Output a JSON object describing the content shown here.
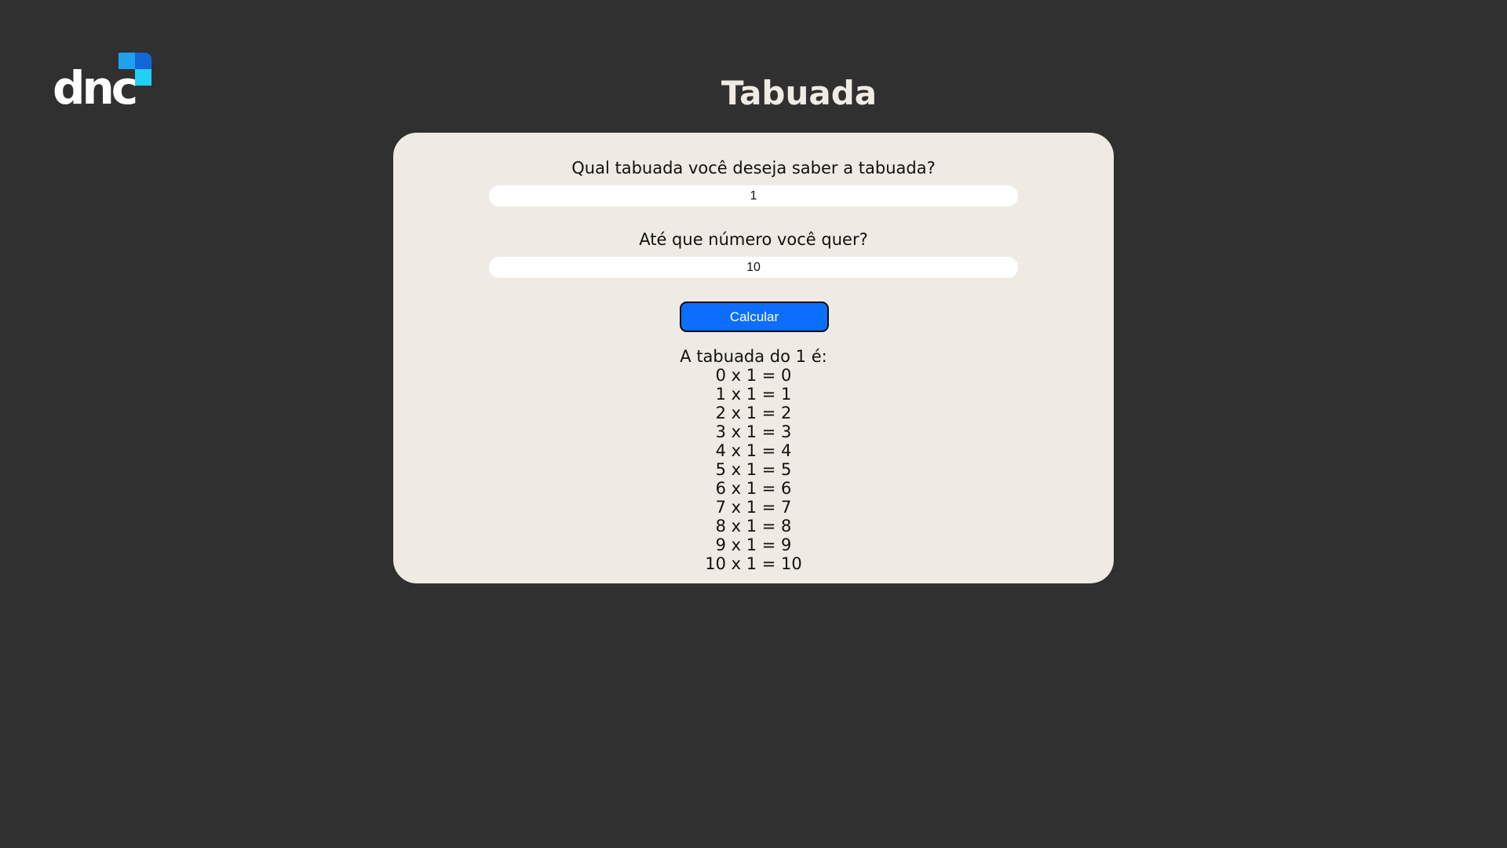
{
  "logo": {
    "text": "dnc",
    "colors": [
      "#1fa2ee",
      "#1167d8",
      "#22d0f5"
    ]
  },
  "title": "Tabuada",
  "form": {
    "question_number": "Qual tabuada você deseja saber a tabuada?",
    "number_value": "1",
    "question_limit": "Até que número você quer?",
    "limit_value": "10",
    "button_label": "Calcular",
    "button_color": "#0d6efd"
  },
  "result": {
    "heading": "A tabuada do 1 é:",
    "lines": [
      "0 x 1 = 0",
      "1 x 1 = 1",
      "2 x 1 = 2",
      "3 x 1 = 3",
      "4 x 1 = 4",
      "5 x 1 = 5",
      "6 x 1 = 6",
      "7 x 1 = 7",
      "8 x 1 = 8",
      "9 x 1 = 9",
      "10 x 1 = 10"
    ]
  },
  "colors": {
    "background": "#303030",
    "card": "#efeae3",
    "title": "#f0ebe4"
  }
}
